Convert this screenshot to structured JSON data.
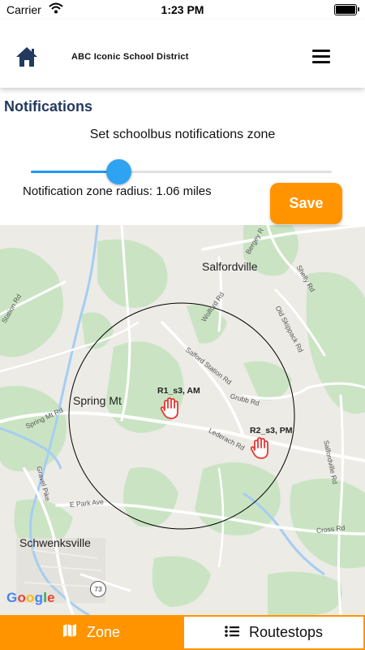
{
  "status_bar": {
    "carrier": "Carrier",
    "time": "1:23 PM"
  },
  "header": {
    "title": "ABC Iconic School District",
    "home_icon": "home-icon",
    "menu_icon": "hamburger-menu-icon"
  },
  "notifications": {
    "title": "Notifications",
    "subtitle": "Set schoolbus notifications zone",
    "slider_fraction": 0.29,
    "radius_label": "Notification zone radius: 1.06 miles",
    "save_label": "Save"
  },
  "map": {
    "places": {
      "salfordville": "Salfordville",
      "spring_mt": "Spring Mt",
      "schwenksville": "Schwenksville"
    },
    "roads": {
      "bergey": "Bergey R",
      "shelly": "Shelly Rd",
      "station": "Station Rd",
      "wolford": "Wolford Rd",
      "old_skippack": "Old Skippack Rd",
      "salford_station": "Salford Station Rd",
      "grubb": "Grubb Rd",
      "lederach": "Lederach Rd",
      "spring_mt_rd": "Spring Mt Rd",
      "gravel_pike": "Gravel Pike",
      "e_park": "E Park Ave",
      "salfordville_rd": "Salfordville Rd",
      "cross": "Cross Rd"
    },
    "route_shield": "73",
    "stops": [
      {
        "label": "R1_s3, AM",
        "icon": "hand-stop-icon"
      },
      {
        "label": "R2_s3, PM",
        "icon": "hand-stop-icon"
      }
    ],
    "attribution": "Google",
    "colors": {
      "circle": "#000000",
      "stop_icon": "#e53935",
      "accent": "#ff9400",
      "slider": "#2196f3"
    }
  },
  "tabs": [
    {
      "label": "Zone",
      "icon": "map-icon",
      "active": true
    },
    {
      "label": "Routestops",
      "icon": "list-icon",
      "active": false
    }
  ]
}
